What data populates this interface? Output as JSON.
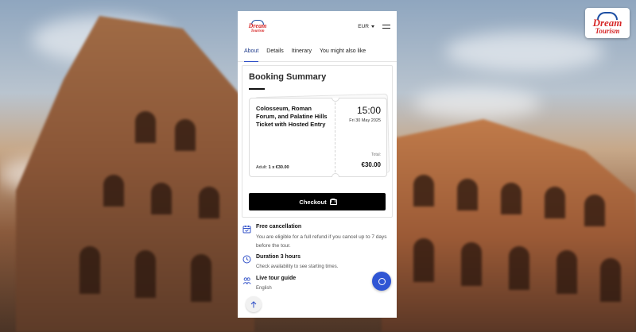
{
  "brand": {
    "logo_line1": "Dream",
    "logo_line2": "Tourism",
    "logo_icon": "colosseum-logo-icon"
  },
  "header": {
    "currency": "EUR",
    "menu_icon": "hamburger-menu-icon"
  },
  "tabs": [
    {
      "label": "About",
      "active": true
    },
    {
      "label": "Details",
      "active": false
    },
    {
      "label": "Itinerary",
      "active": false
    },
    {
      "label": "You might also like",
      "active": false
    }
  ],
  "booking": {
    "title": "Booking Summary",
    "product_name": "Colosseum, Roman Forum, and Palatine Hills Ticket with Hosted Entry",
    "adult_label": "Adult:",
    "adult_value": "1 x €30.00",
    "time": "15:00",
    "date": "Fri 30 May 2025",
    "total_label": "Total:",
    "total": "€30.00",
    "checkout_label": "Checkout"
  },
  "features": [
    {
      "icon": "calendar-check-icon",
      "title": "Free cancellation",
      "desc": "You are eligible for a full refund if you cancel up to 7 days before the tour."
    },
    {
      "icon": "clock-icon",
      "title": "Duration 3 hours",
      "desc": "Check availability to see starting times."
    },
    {
      "icon": "people-icon",
      "title": "Live tour guide",
      "desc": "English"
    }
  ],
  "colors": {
    "accent": "#2f4fc7",
    "brand_red": "#d62828",
    "checkout_bg": "#000000",
    "chat_button": "#2f55d4"
  }
}
